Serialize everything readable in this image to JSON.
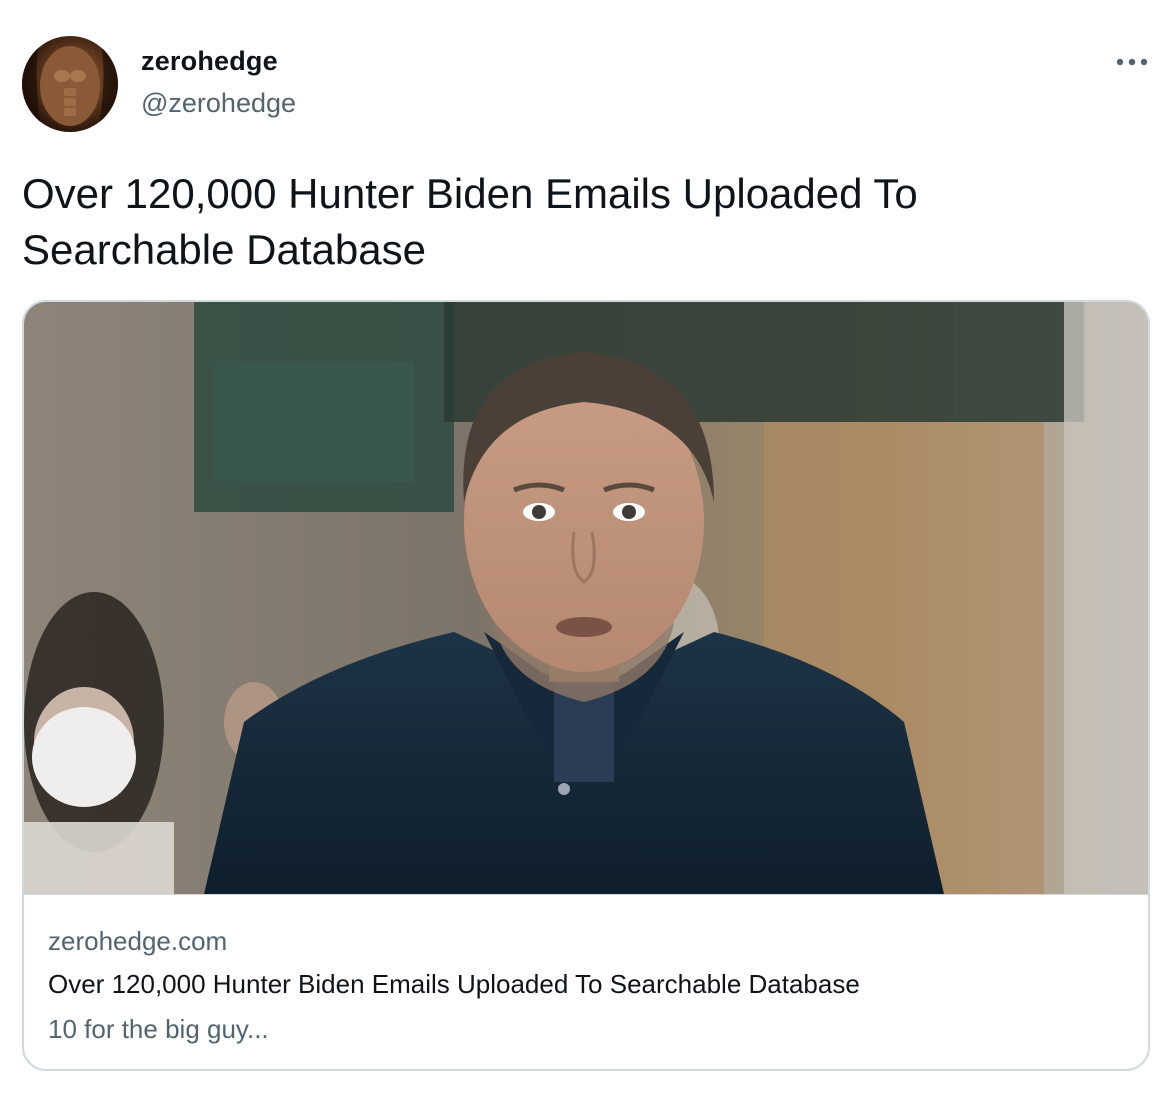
{
  "author": {
    "display_name": "zerohedge",
    "handle": "@zerohedge",
    "avatar_icon": "avatar-photo"
  },
  "menu": {
    "more_icon": "more-horizontal-icon"
  },
  "tweet": {
    "text": "Over 120,000 Hunter Biden Emails Uploaded To Searchable Database"
  },
  "link_card": {
    "domain": "zerohedge.com",
    "title": "Over 120,000 Hunter Biden Emails Uploaded To Searchable Database",
    "description": "10 for the big guy..."
  },
  "colors": {
    "text_primary": "#0f1419",
    "text_secondary": "#536471",
    "border": "#cfd9de",
    "background": "#ffffff"
  }
}
